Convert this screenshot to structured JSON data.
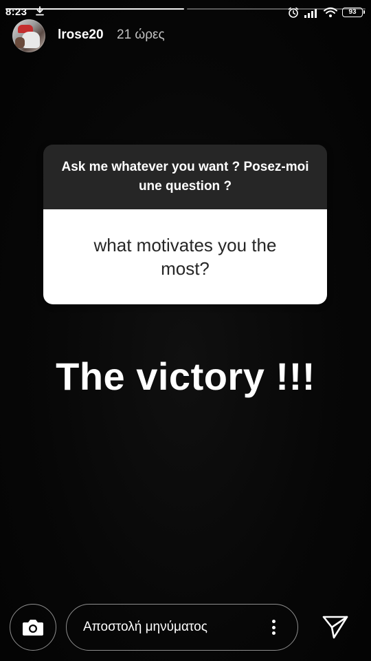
{
  "status_bar": {
    "time": "8:23",
    "battery": "93",
    "icons": [
      "download-icon",
      "alarm-icon",
      "signal-icon",
      "wifi-icon",
      "battery-icon"
    ]
  },
  "story": {
    "segments": 2,
    "active_segment": 1,
    "username": "lrose20",
    "time_ago": "21 ώρες"
  },
  "question_card": {
    "prompt": "Ask me whatever you want ? Posez-moi une question ?",
    "question": "what motivates you the most?"
  },
  "answer_text": "The victory !!!",
  "reply_bar": {
    "placeholder": "Αποστολή μηνύματος",
    "icons": [
      "camera-icon",
      "more-options-icon",
      "send-icon"
    ]
  },
  "colors": {
    "background": "#050505",
    "card_header": "#262626",
    "card_body": "#ffffff",
    "text": "#ffffff"
  }
}
